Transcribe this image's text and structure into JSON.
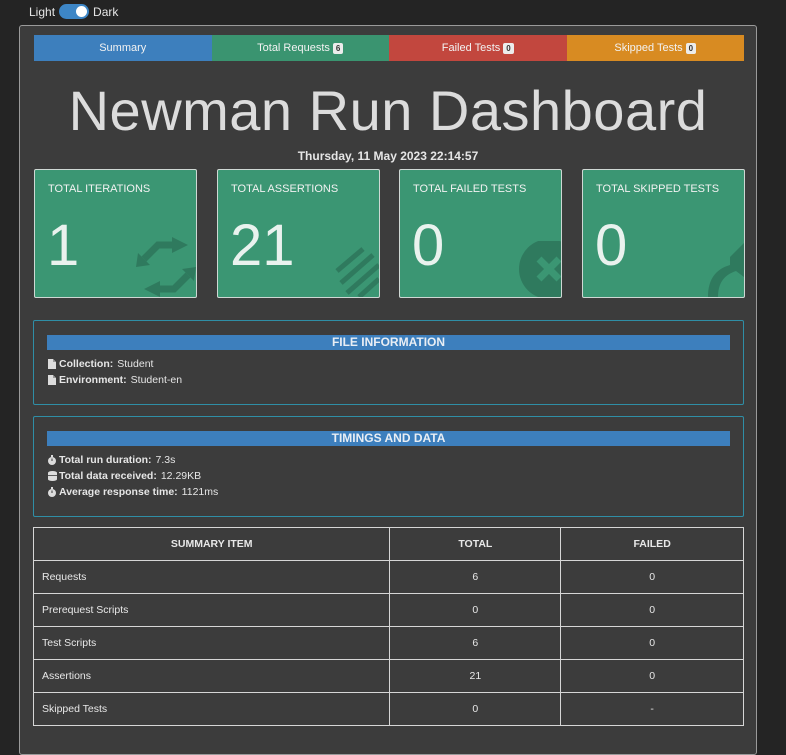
{
  "theme": {
    "light_label": "Light",
    "dark_label": "Dark"
  },
  "tabs": [
    {
      "label": "Summary",
      "badge": null,
      "color": "#3d7fbd"
    },
    {
      "label": "Total Requests",
      "badge": "6",
      "color": "#3a9470"
    },
    {
      "label": "Failed Tests",
      "badge": "0",
      "color": "#c2473e"
    },
    {
      "label": "Skipped Tests",
      "badge": "0",
      "color": "#d88b22"
    }
  ],
  "title": "Newman Run Dashboard",
  "timestamp": "Thursday, 11 May 2023 22:14:57",
  "cards": [
    {
      "label": "TOTAL ITERATIONS",
      "value": "1",
      "icon": "refresh-icon"
    },
    {
      "label": "TOTAL ASSERTIONS",
      "value": "21",
      "icon": "list-check-icon"
    },
    {
      "label": "TOTAL FAILED TESTS",
      "value": "0",
      "icon": "times-circle-icon"
    },
    {
      "label": "TOTAL SKIPPED TESTS",
      "value": "0",
      "icon": "share-icon"
    }
  ],
  "file_info": {
    "header": "FILE INFORMATION",
    "rows": [
      {
        "label": "Collection:",
        "value": "Student",
        "icon": "file-icon"
      },
      {
        "label": "Environment:",
        "value": "Student-en",
        "icon": "file-icon"
      }
    ]
  },
  "timings": {
    "header": "TIMINGS AND DATA",
    "rows": [
      {
        "label": "Total run duration:",
        "value": "7.3s",
        "icon": "stopwatch-icon"
      },
      {
        "label": "Total data received:",
        "value": "12.29KB",
        "icon": "database-icon"
      },
      {
        "label": "Average response time:",
        "value": "1121ms",
        "icon": "stopwatch-icon"
      }
    ]
  },
  "summary_table": {
    "headers": [
      "SUMMARY ITEM",
      "TOTAL",
      "FAILED"
    ],
    "rows": [
      [
        "Requests",
        "6",
        "0"
      ],
      [
        "Prerequest Scripts",
        "0",
        "0"
      ],
      [
        "Test Scripts",
        "6",
        "0"
      ],
      [
        "Assertions",
        "21",
        "0"
      ],
      [
        "Skipped Tests",
        "0",
        "-"
      ]
    ]
  }
}
